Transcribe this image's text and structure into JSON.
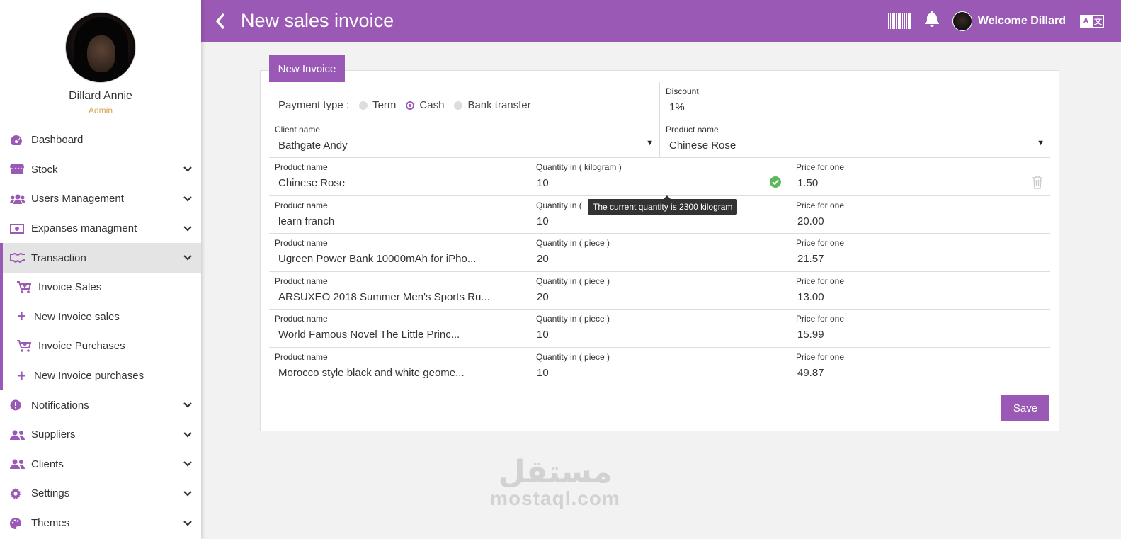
{
  "sidebar": {
    "user_name": "Dillard Annie",
    "user_role": "Admin",
    "items": [
      {
        "label": "Dashboard",
        "icon": "dashboard-icon"
      },
      {
        "label": "Stock",
        "icon": "store-icon"
      },
      {
        "label": "Users Management",
        "icon": "users-icon"
      },
      {
        "label": "Expanses managment",
        "icon": "money-icon"
      },
      {
        "label": "Transaction",
        "icon": "handshake-icon"
      },
      {
        "label": "Invoice Sales",
        "icon": "cart-icon"
      },
      {
        "label": "New Invoice sales",
        "icon": "plus-icon"
      },
      {
        "label": "Invoice Purchases",
        "icon": "cart-icon"
      },
      {
        "label": "New Invoice purchases",
        "icon": "plus-icon"
      },
      {
        "label": "Notifications",
        "icon": "alert-icon"
      },
      {
        "label": "Suppliers",
        "icon": "users-icon"
      },
      {
        "label": "Clients",
        "icon": "users-icon"
      },
      {
        "label": "Settings",
        "icon": "gear-icon"
      },
      {
        "label": "Themes",
        "icon": "palette-icon"
      }
    ]
  },
  "header": {
    "title": "New sales invoice",
    "welcome": "Welcome Dillard",
    "lang_a": "A",
    "lang_b": "文"
  },
  "invoice": {
    "tab_label": "New Invoice",
    "payment_label": "Payment type :",
    "payment_options": [
      "Term",
      "Cash",
      "Bank transfer"
    ],
    "payment_selected": "Cash",
    "discount_label": "Discount",
    "discount_value": "1%",
    "client_label": "Client name",
    "client_value": "Bathgate Andy",
    "product_select_label": "Product name",
    "product_select_value": "Chinese Rose",
    "product_label": "Product name",
    "price_label": "Price for one",
    "tooltip": "The current quantity is 2300 kilogram",
    "lines": [
      {
        "product": "Chinese Rose",
        "qty_label": "Quantity in ( kilogram )",
        "qty": "10",
        "price": "1.50"
      },
      {
        "product": "learn franch",
        "qty_label": "Quantity in (",
        "qty": "10",
        "price": "20.00"
      },
      {
        "product": "Ugreen Power Bank 10000mAh for iPho...",
        "qty_label": "Quantity in ( piece )",
        "qty": "20",
        "price": "21.57"
      },
      {
        "product": "ARSUXEO 2018 Summer Men's Sports Ru...",
        "qty_label": "Quantity in ( piece )",
        "qty": "20",
        "price": "13.00"
      },
      {
        "product": "World Famous Novel The Little Princ...",
        "qty_label": "Quantity in ( piece )",
        "qty": "10",
        "price": "15.99"
      },
      {
        "product": "Morocco style black and white geome...",
        "qty_label": "Quantity in ( piece )",
        "qty": "10",
        "price": "49.87"
      }
    ],
    "save_label": "Save"
  },
  "watermark": {
    "arabic": "مستقل",
    "latin": "mostaql.com"
  },
  "colors": {
    "accent": "#9b59b6",
    "success": "#5cb85c",
    "role": "#d4a44a"
  }
}
